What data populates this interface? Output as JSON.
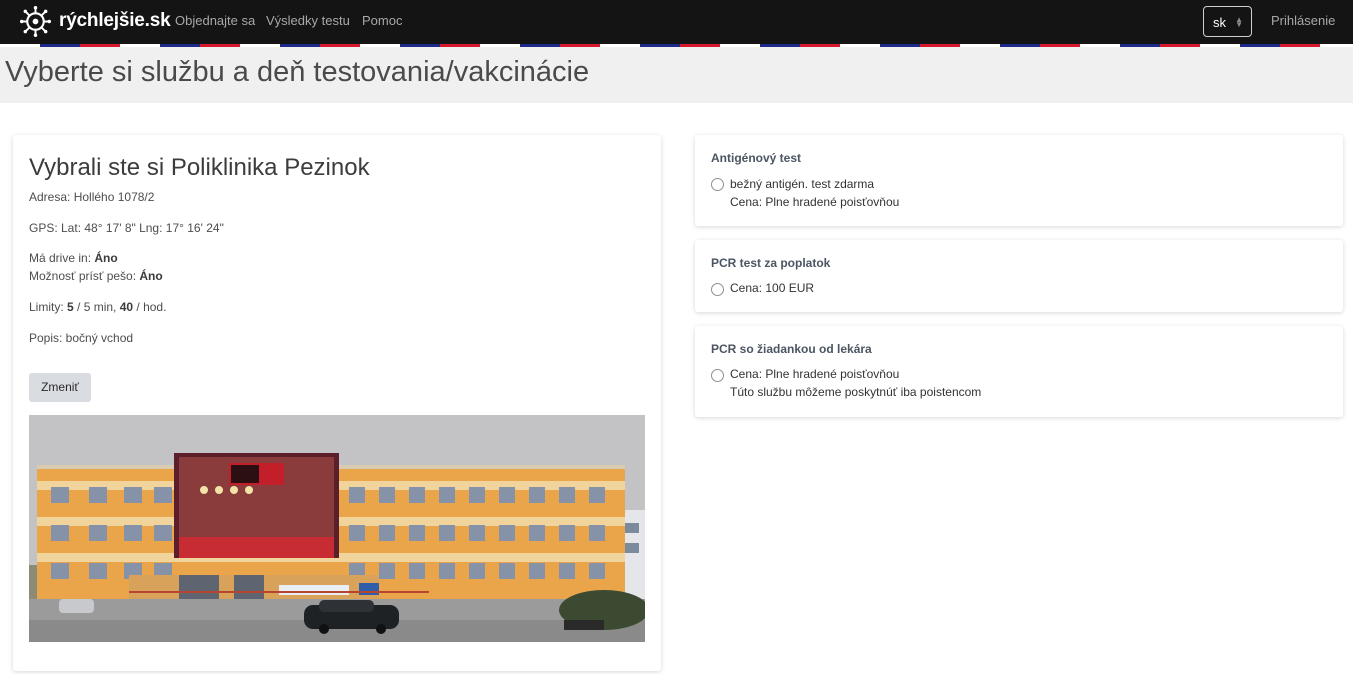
{
  "brand": {
    "name": "rýchlejšie.sk",
    "logo": "virus-logo-icon"
  },
  "nav": {
    "links": [
      "Objednajte sa",
      "Výsledky testu",
      "Pomoc"
    ],
    "language": "sk",
    "login": "Prihlásenie"
  },
  "colors": {
    "navbar": "#141414",
    "flag_blue": "#1d2a8a",
    "flag_red": "#d5162b",
    "title_band": "#f0f0f0"
  },
  "page_title": "Vyberte si službu a deň testovania/vakcinácie",
  "location": {
    "title": "Vybrali ste si Poliklinika Pezinok",
    "address": "Adresa: Hollého 1078/2",
    "gps": "GPS: Lat: 48° 17' 8\" Lng: 17° 16' 24\"",
    "drive_in_label": "Má drive in: ",
    "drive_in_value": "Áno",
    "walk_in_label": "Možnosť prísť pešo: ",
    "walk_in_value": "Áno",
    "limits_label": "Limity: ",
    "limits_a": "5",
    "limits_b": " / 5 min, ",
    "limits_c": "40",
    "limits_d": " / hod.",
    "description": "Popis: bočný vchod",
    "change_button": "Zmeniť",
    "photo": "building-photo"
  },
  "services": [
    {
      "title": "Antigénový test",
      "option": "bežný antigén. test zdarma",
      "note": "Cena: Plne hradené poisťovňou"
    },
    {
      "title": "PCR test za poplatok",
      "option": "Cena: 100 EUR"
    },
    {
      "title": "PCR so žiadankou od lekára",
      "option": "Cena: Plne hradené poisťovňou",
      "note": "Túto službu môžeme poskytnúť iba poistencom"
    }
  ]
}
